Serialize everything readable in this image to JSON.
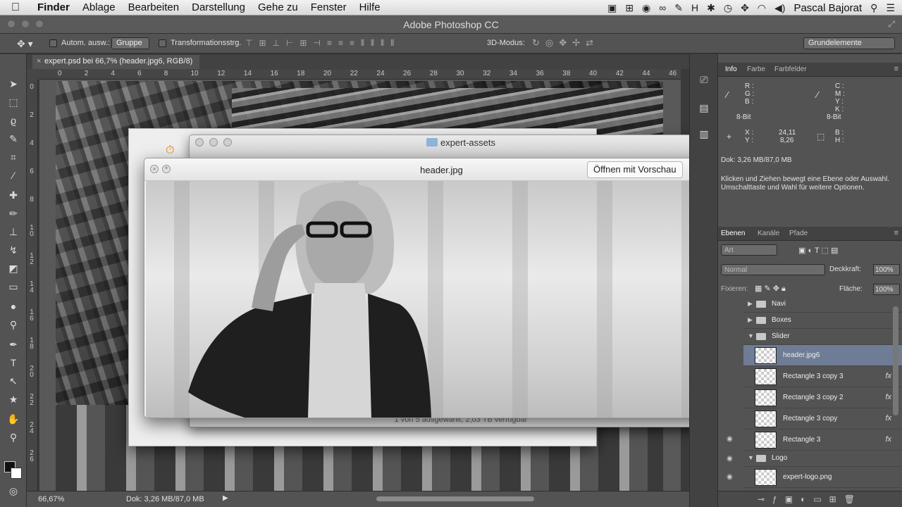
{
  "menubar": {
    "apple": "",
    "app": "Finder",
    "items": [
      "Ablage",
      "Bearbeiten",
      "Darstellung",
      "Gehe zu",
      "Fenster",
      "Hilfe"
    ],
    "user": "Pascal Bajorat",
    "h_glyph": "H",
    "status_icons": [
      "screen-record-icon",
      "grid-icon",
      "evernote-icon",
      "creative-cloud-icon",
      "adobe-icon",
      "h-icon",
      "bluetooth-icon",
      "time-machine-icon",
      "move-icon",
      "wifi-icon",
      "volume-icon",
      "user-name",
      "spotlight-icon",
      "list-icon"
    ]
  },
  "ps": {
    "window_title": "Adobe Photoshop CC",
    "options": {
      "auto_select_label": "Autom. ausw.:",
      "auto_select_value": "Gruppe",
      "transform_label": "Transformationsstrg.",
      "mode3d_label": "3D-Modus:",
      "workspace": "Grundelemente"
    },
    "document_tab": "expert.psd bei 66,7% (header.jpg6, RGB/8)",
    "ruler_h": [
      "0",
      "2",
      "4",
      "6",
      "8",
      "10",
      "12",
      "14",
      "16",
      "18",
      "20",
      "22",
      "24",
      "26",
      "28",
      "30",
      "32",
      "34",
      "36",
      "38",
      "40",
      "42",
      "44",
      "46"
    ],
    "ruler_v": [
      "0",
      "2",
      "4",
      "6",
      "8",
      "1 0",
      "1 2",
      "1 4",
      "1 6",
      "1 8",
      "2 0",
      "2 2",
      "2 4",
      "2 6"
    ],
    "status": {
      "zoom": "66,67%",
      "doc_size": "Dok: 3,26 MB/87,0 MB"
    }
  },
  "finder": {
    "title": "expert-assets",
    "status": "1 von 5 ausgewählt, 2,03 TB verfügbar"
  },
  "quicklook": {
    "title": "header.jpg",
    "open_button": "Öffnen mit Vorschau"
  },
  "info_panel": {
    "tabs": [
      "Info",
      "Farbe",
      "Farbfelder"
    ],
    "rgb": [
      "R :",
      "G :",
      "B :"
    ],
    "cmyk": [
      "C :",
      "M :",
      "Y :",
      "K :"
    ],
    "bit_left": "8-Bit",
    "bit_right": "8-Bit",
    "x_label": "X :",
    "x_value": "24,11",
    "y_label": "Y :",
    "y_value": "8,26",
    "wh": [
      "B :",
      "H :"
    ],
    "doc": "Dok: 3,26 MB/87,0 MB",
    "hint1": "Klicken und Ziehen bewegt eine Ebene oder Auswahl.",
    "hint2": "Umschalttaste und Wahl für weitere Optionen."
  },
  "layers_panel": {
    "tabs": [
      "Ebenen",
      "Kanäle",
      "Pfade"
    ],
    "kind": "Art",
    "blend": "Normal",
    "opacity_label": "Deckkraft:",
    "opacity_value": "100%",
    "fill_label": "Fläche:",
    "fill_value": "100%",
    "lock_label": "Fixieren:",
    "groups": [
      "Navi",
      "Boxes",
      "Slider",
      "Logo"
    ],
    "layers": [
      {
        "name": "header.jpg6",
        "fx": ""
      },
      {
        "name": "Rectangle 3 copy 3",
        "fx": "fx"
      },
      {
        "name": "Rectangle 3 copy 2",
        "fx": "fx"
      },
      {
        "name": "Rectangle 3 copy",
        "fx": "fx"
      },
      {
        "name": "Rectangle 3",
        "fx": "fx"
      },
      {
        "name": "expert-logo.png",
        "fx": ""
      }
    ]
  }
}
